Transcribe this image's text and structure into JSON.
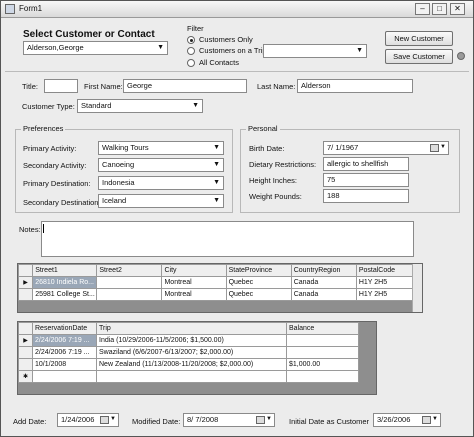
{
  "window": {
    "title": "Form1",
    "min": "–",
    "max": "□",
    "close": "✕"
  },
  "select": {
    "heading": "Select Customer or Contact",
    "value": "Alderson,George"
  },
  "filter": {
    "title": "Filter",
    "options": [
      "Customers Only",
      "Customers on a Trip",
      "All Contacts"
    ],
    "selected": 0,
    "trip_value": ""
  },
  "buttons": {
    "new": "New Customer",
    "save": "Save Customer"
  },
  "name": {
    "title_label": "Title:",
    "title_value": "",
    "first_label": "First Name:",
    "first_value": "George",
    "last_label": "Last Name:",
    "last_value": "Alderson"
  },
  "customer_type": {
    "label": "Customer Type:",
    "value": "Standard"
  },
  "preferences": {
    "title": "Preferences",
    "primary_activity": {
      "label": "Primary Activity:",
      "value": "Walking Tours"
    },
    "secondary_activity": {
      "label": "Secondary Activity:",
      "value": "Canoeing"
    },
    "primary_destination": {
      "label": "Primary Destination:",
      "value": "Indonesia"
    },
    "secondary_destination": {
      "label": "Secondary Destination:",
      "value": "Iceland"
    }
  },
  "personal": {
    "title": "Personal",
    "birth_date": {
      "label": "Birth Date:",
      "value": "7/  1/1967"
    },
    "dietary": {
      "label": "Dietary Restrictions:",
      "value": "allergic to shellfish"
    },
    "height": {
      "label": "Height Inches:",
      "value": "75"
    },
    "weight": {
      "label": "Weight Pounds:",
      "value": "188"
    }
  },
  "notes": {
    "label": "Notes:",
    "value": ""
  },
  "addresses": {
    "columns": [
      "Street1",
      "Street2",
      "City",
      "StateProvince",
      "CountryRegion",
      "PostalCode"
    ],
    "rows": [
      [
        "26810 Indiela Ro...",
        "",
        "Montreal",
        "Quebec",
        "Canada",
        "H1Y 2H5"
      ],
      [
        "25981 College St...",
        "",
        "Montreal",
        "Quebec",
        "Canada",
        "H1Y 2H5"
      ]
    ]
  },
  "reservations": {
    "columns": [
      "ReservationDate",
      "Trip",
      "Balance"
    ],
    "rows": [
      [
        "2/24/2006 7:19 ...",
        "India (10/29/2006-11/5/2006;  $1,500.00)",
        ""
      ],
      [
        "2/24/2006 7:19 ...",
        "Swaziland (6/6/2007-6/13/2007;  $2,000.00)",
        ""
      ],
      [
        "10/1/2008",
        "New Zealand (11/13/2008-11/20/2008;  $2,000.00)",
        "$1,000.00"
      ]
    ],
    "new_row_marker": "✱"
  },
  "footer": {
    "add_date": {
      "label": "Add Date:",
      "value": "1/24/2006"
    },
    "modified_date": {
      "label": "Modified Date:",
      "value": "8/  7/2008"
    },
    "initial_date": {
      "label": "Initial Date as Customer",
      "value": "3/26/2006"
    }
  },
  "icons": {
    "dropdown": "chevron-down-icon",
    "row_pointer": "row-pointer-icon",
    "calendar": "calendar-icon"
  },
  "colors": {
    "selected_cell": "#9aa7b7",
    "grid_bg": "#8e8e8e"
  }
}
